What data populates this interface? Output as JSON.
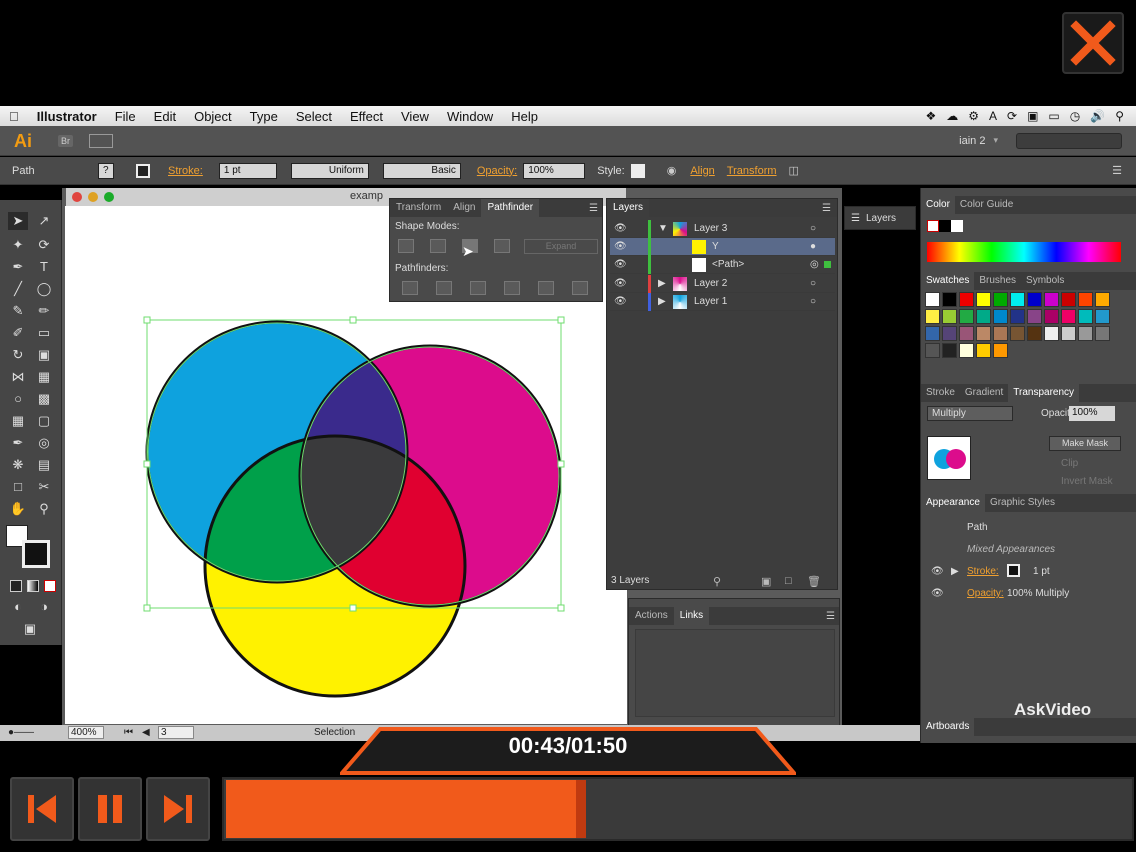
{
  "menubar": {
    "app": "Illustrator",
    "items": [
      "File",
      "Edit",
      "Object",
      "Type",
      "Select",
      "Effect",
      "View",
      "Window",
      "Help"
    ]
  },
  "appbar": {
    "logo": "Ai",
    "bridge": "Br",
    "workspace": "iain 2",
    "search_placeholder": ""
  },
  "controlbar": {
    "selection_type": "Path",
    "stroke_label": "Stroke:",
    "stroke_value": "1 pt",
    "profile": "Uniform",
    "brush": "Basic",
    "opacity_label": "Opacity:",
    "opacity_value": "100%",
    "style_label": "Style:",
    "align_label": "Align",
    "transform_label": "Transform"
  },
  "document": {
    "tab_title": "examp",
    "zoom": "400%",
    "artboard": "3",
    "status_tool": "Selection"
  },
  "pathfinder": {
    "tabs": [
      "Transform",
      "Align",
      "Pathfinder"
    ],
    "shape_modes_label": "Shape Modes:",
    "expand_label": "Expand",
    "pathfinders_label": "Pathfinders:"
  },
  "layers": {
    "tab": "Layers",
    "rows": [
      {
        "name": "Layer 3",
        "color": "#3fbf3f"
      },
      {
        "name": "Y",
        "color": "#3fbf3f"
      },
      {
        "name": "<Path>",
        "color": "#3fbf3f"
      },
      {
        "name": "Layer 2",
        "color": "#e04040"
      },
      {
        "name": "Layer 1",
        "color": "#4060e0"
      }
    ],
    "footer": "3 Layers"
  },
  "actions_links": {
    "tabs": [
      "Actions",
      "Links"
    ]
  },
  "collapsed_layers_button": "Layers",
  "right_dock": {
    "color_tabs": [
      "Color",
      "Color Guide"
    ],
    "swatches_tabs": [
      "Swatches",
      "Brushes",
      "Symbols"
    ],
    "transparency_tabs": [
      "Stroke",
      "Gradient",
      "Transparency"
    ],
    "blend_mode": "Multiply",
    "opacity_label": "Opacity:",
    "opacity_value": "100%",
    "make_mask": "Make Mask",
    "clip": "Clip",
    "invert_mask": "Invert Mask",
    "appearance_tabs": [
      "Appearance",
      "Graphic Styles"
    ],
    "appearance_title": "Path",
    "mixed": "Mixed Appearances",
    "stroke_label": "Stroke:",
    "stroke_value": "1 pt",
    "opacity_row_label": "Opacity:",
    "opacity_row_value": "100% Multiply",
    "artboards_tab": "Artboards"
  },
  "player": {
    "time": "00:43/01:50",
    "progress": 0.395,
    "accent": "#f15a1b",
    "brand": "AskVideo"
  }
}
